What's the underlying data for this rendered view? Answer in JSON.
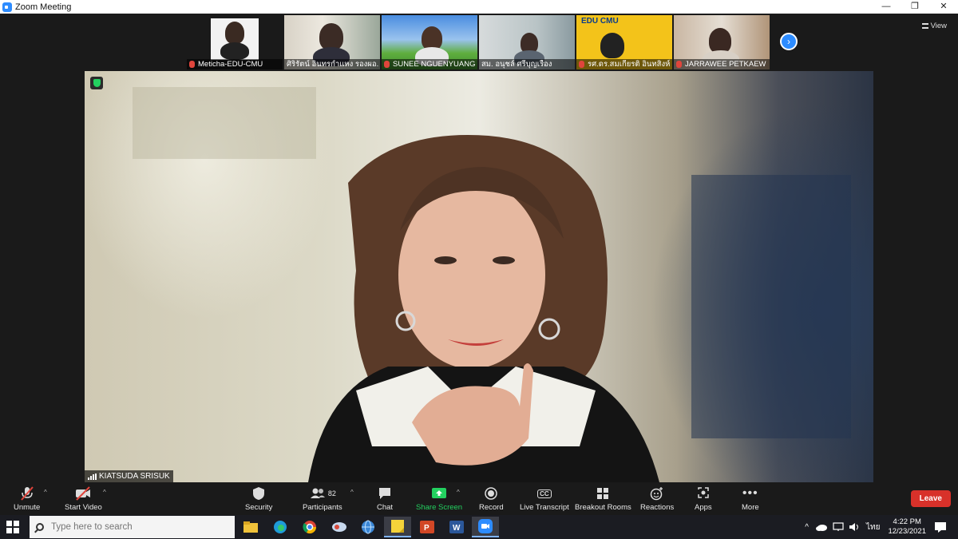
{
  "window": {
    "title": "Zoom Meeting",
    "controls": [
      "—",
      "❐",
      "✕"
    ]
  },
  "gallery": {
    "participants": [
      {
        "name": "Meticha-EDU-CMU",
        "muted": true
      },
      {
        "name": "ศิริรัตน์ อินทรกำแหง  รองผอ.",
        "muted": false
      },
      {
        "name": "SUNEE NGUENYUANG",
        "muted": true
      },
      {
        "name": "สม. อนุชล์ ศรีบุญเรือง",
        "muted": false
      },
      {
        "name": "รศ.ดร.สมเกียรติ อินทสิงห์",
        "muted": true
      },
      {
        "name": "JARRAWEE PETKAEW",
        "muted": true
      }
    ],
    "logo_text": "EDU CMU",
    "view_label": "View"
  },
  "main": {
    "speaker_name": "KIATSUDA SRISUK"
  },
  "toolbar": {
    "unmute": "Unmute",
    "start_video": "Start Video",
    "security": "Security",
    "participants": "Participants",
    "participant_count": "82",
    "chat": "Chat",
    "share_screen": "Share Screen",
    "record": "Record",
    "live_transcript": "Live Transcript",
    "breakout_rooms": "Breakout Rooms",
    "reactions": "Reactions",
    "apps": "Apps",
    "more": "More",
    "leave": "Leave",
    "cc_badge": "CC"
  },
  "taskbar": {
    "search_placeholder": "Type here to search",
    "language": "ไทย",
    "time": "4:22 PM",
    "date": "12/23/2021"
  },
  "colors": {
    "zoom_blue": "#2d8cff",
    "leave_red": "#d8312a",
    "share_green": "#23d160",
    "muted_red": "#e0453c"
  }
}
